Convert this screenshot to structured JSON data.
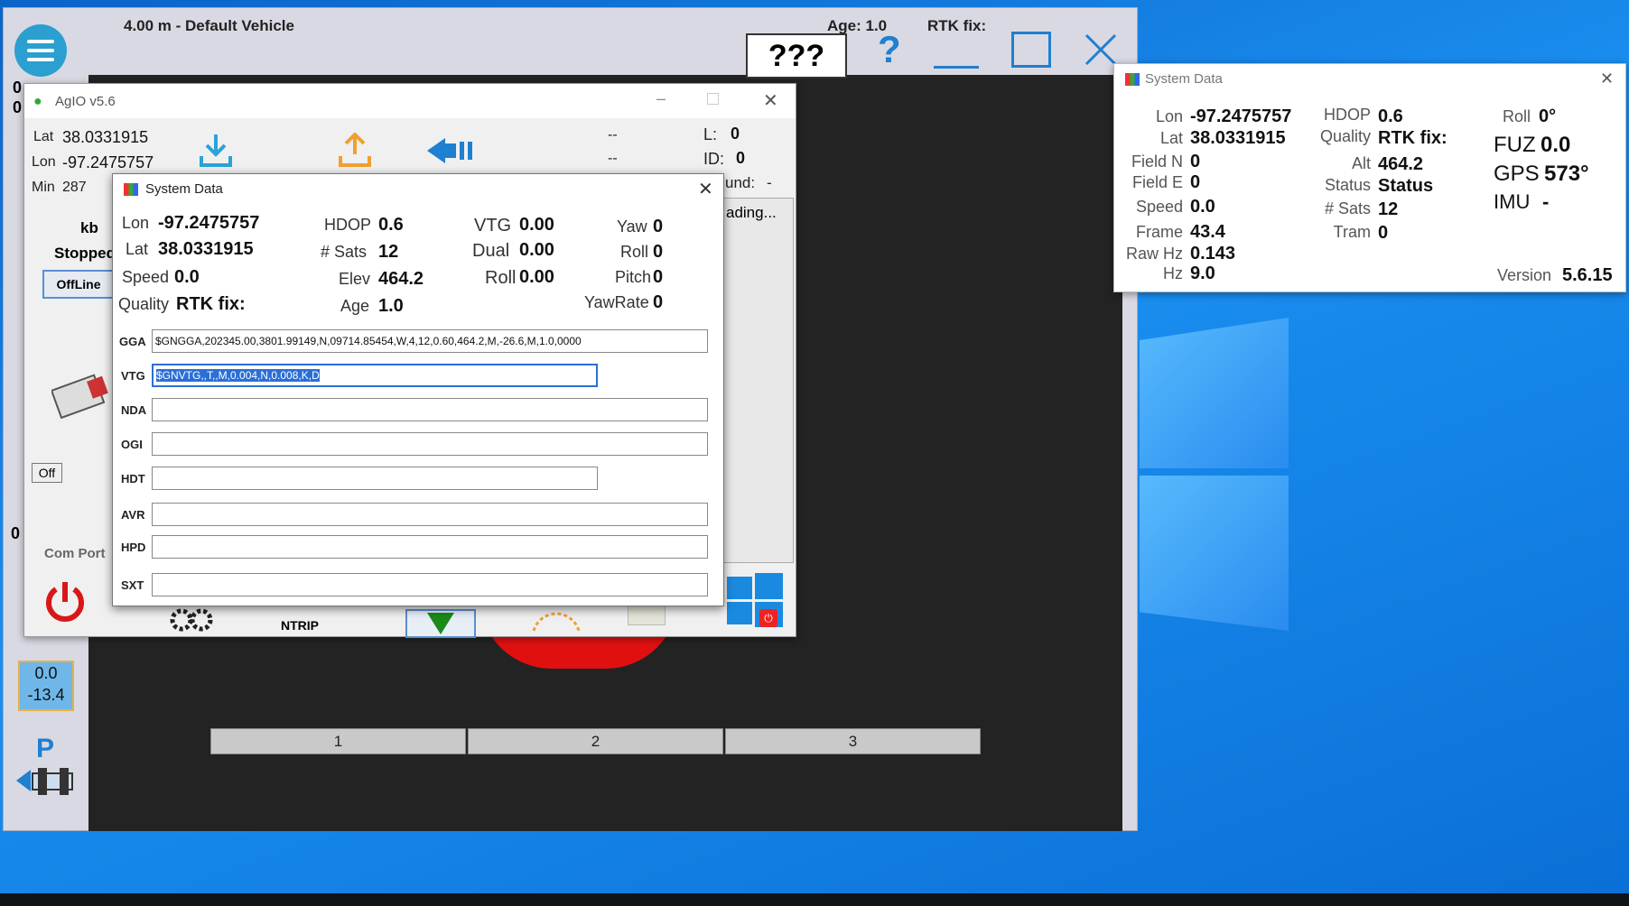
{
  "agopen": {
    "vehicle_label": "4.00 m - Default Vehicle",
    "age_label": "Age: 1.0",
    "rtk_label": "RTK fix:",
    "status_box": "???",
    "left_zero_1": "0",
    "left_zero_2": "0",
    "left_zero_3": "0",
    "kb_label": "kb",
    "stopped_label": "Stopped",
    "offline_label": "OffLine",
    "off_label": "Off",
    "com_port_label": "Com Port",
    "speed_box_line1": "0.0",
    "speed_box_line2": "-13.4",
    "p_label": "P",
    "track_buttons": [
      "1",
      "2",
      "3"
    ]
  },
  "agio": {
    "title": "AgIO v5.6",
    "lat_label": "Lat",
    "lat_value": "38.0331915",
    "lon_label": "Lon",
    "lon_value": "-97.2475757",
    "min_label": "Min",
    "min_value": "287",
    "dash1": "--",
    "dash2": "--",
    "l_label": "L:",
    "l_value": "0",
    "id_label": "ID:",
    "id_value": "0",
    "und_label": "und:",
    "und_value": "-",
    "reading_label": "ading...",
    "ntrip_label": "NTRIP"
  },
  "sysdlg": {
    "title": "System Data",
    "lon_label": "Lon",
    "lon_value": "-97.2475757",
    "lat_label": "Lat",
    "lat_value": "38.0331915",
    "speed_label": "Speed",
    "speed_value": "0.0",
    "quality_label": "Quality",
    "quality_value": "RTK fix:",
    "hdop_label": "HDOP",
    "hdop_value": "0.6",
    "sats_label": "# Sats",
    "sats_value": "12",
    "elev_label": "Elev",
    "elev_value": "464.2",
    "age_label": "Age",
    "age_value": "1.0",
    "vtg_label": "VTG",
    "vtg_value": "0.00",
    "dual_label": "Dual",
    "dual_value": "0.00",
    "roll_label": "Roll",
    "roll_value": "0.00",
    "yaw_label": "Yaw",
    "yaw_value": "0",
    "roll2_label": "Roll",
    "roll2_value": "0",
    "pitch_label": "Pitch",
    "pitch_value": "0",
    "yawrate_label": "YawRate",
    "yawrate_value": "0",
    "nmea": [
      {
        "label": "GGA",
        "value": "$GNGGA,202345.00,3801.99149,N,09714.85454,W,4,12,0.60,464.2,M,-26.6,M,1.0,0000"
      },
      {
        "label": "VTG",
        "value": "$GNVTG,,T,,M,0.004,N,0.008,K,D"
      },
      {
        "label": "NDA",
        "value": ""
      },
      {
        "label": "OGI",
        "value": ""
      },
      {
        "label": "HDT",
        "value": ""
      },
      {
        "label": "AVR",
        "value": ""
      },
      {
        "label": "HPD",
        "value": ""
      },
      {
        "label": "SXT",
        "value": ""
      }
    ]
  },
  "sysdata2": {
    "title": "System Data",
    "lon_label": "Lon",
    "lon_value": "-97.2475757",
    "lat_label": "Lat",
    "lat_value": "38.0331915",
    "fieldn_label": "Field N",
    "fieldn_value": "0",
    "fielde_label": "Field E",
    "fielde_value": "0",
    "speed_label": "Speed",
    "speed_value": "0.0",
    "frame_label": "Frame",
    "frame_value": "43.4",
    "rawhz_label": "Raw Hz",
    "rawhz_value": "0.143",
    "hz_label": "Hz",
    "hz_value": "9.0",
    "hdop_label": "HDOP",
    "hdop_value": "0.6",
    "quality_label": "Quality",
    "quality_value": "RTK fix:",
    "alt_label": "Alt",
    "alt_value": "464.2",
    "status_label": "Status",
    "status_value": "Status",
    "sats_label": "# Sats",
    "sats_value": "12",
    "tram_label": "Tram",
    "tram_value": "0",
    "roll_label": "Roll",
    "roll_value": "0°",
    "fuz_label": "FUZ",
    "fuz_value": "0.0",
    "gps_label": "GPS",
    "gps_value": "573°",
    "imu_label": "IMU",
    "imu_value": "-",
    "version_label": "Version",
    "version_value": "5.6.15"
  },
  "colors": {
    "accent_blue": "#1f7fd0",
    "selection_blue": "#2a6fd6",
    "power_red": "#e01010"
  }
}
